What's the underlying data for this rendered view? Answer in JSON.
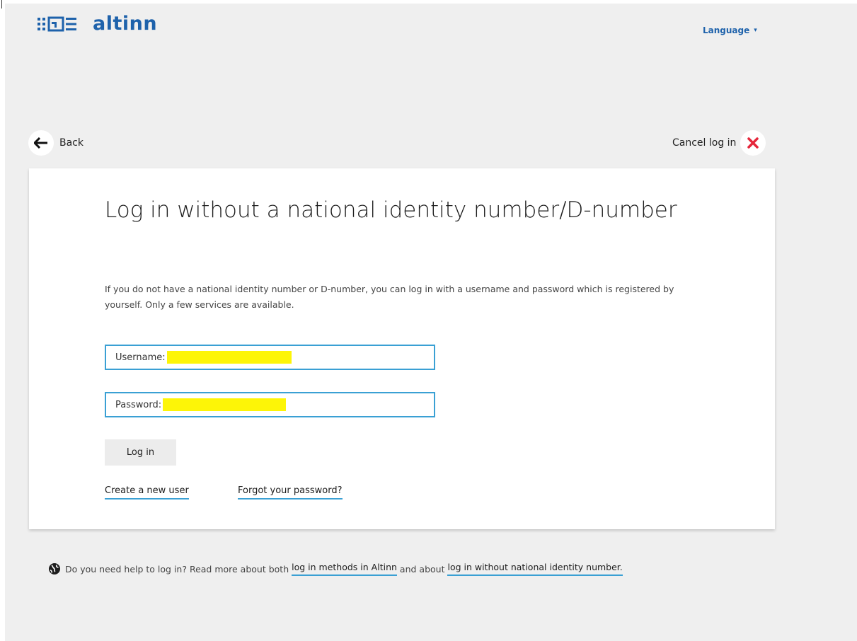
{
  "header": {
    "logo_text": "altinn",
    "language_label": "Language",
    "brand_color": "#1e62ab"
  },
  "nav": {
    "back_label": "Back",
    "cancel_label": "Cancel log in",
    "cancel_icon_color": "#e5263a"
  },
  "login": {
    "title": "Log in without a national identity number/D-number",
    "intro": "If you do not have a national identity number or D-number, you can log in with a username and password which is registered by yourself. Only a few services are available.",
    "username_label": "Username:",
    "username_value": "",
    "password_label": "Password:",
    "password_value": "",
    "submit_label": "Log in",
    "create_user_link": "Create a new user",
    "forgot_password_link": "Forgot your password?",
    "accent_color": "#3aa0d4",
    "redaction_color": "#fdf507"
  },
  "help": {
    "text_before": "Do you need help to log in? Read more about both",
    "link_methods": "log in methods in Altinn",
    "text_middle": "and about",
    "link_no_id": "log in without national identity number."
  }
}
